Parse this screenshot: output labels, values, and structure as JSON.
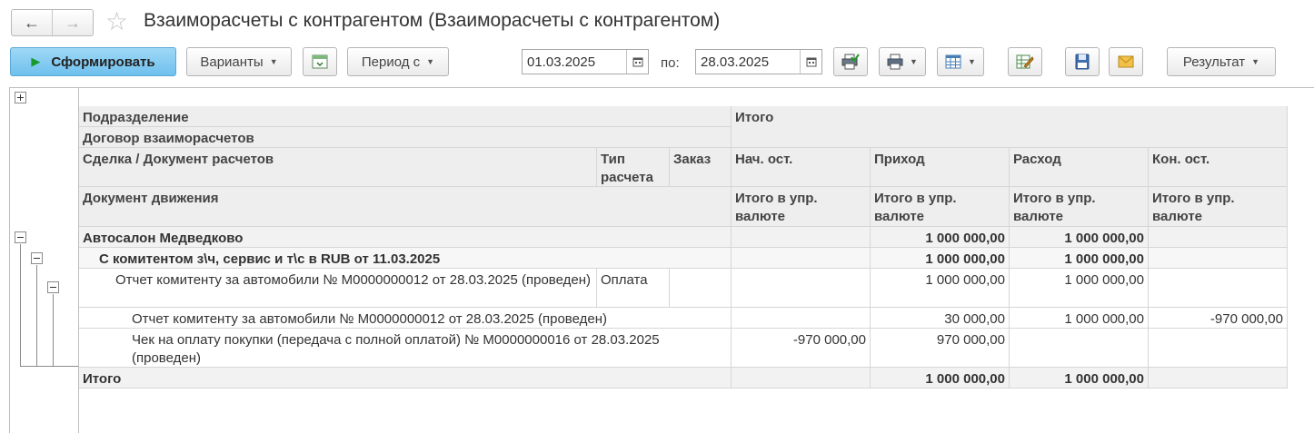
{
  "window": {
    "title": "Взаиморасчеты с контрагентом (Взаиморасчеты с контрагентом)"
  },
  "nav": {
    "back_icon": "arrow-left-icon",
    "forward_icon": "arrow-right-icon",
    "favorite_icon": "star-icon"
  },
  "toolbar": {
    "generate_label": "Сформировать",
    "variants_label": "Варианты",
    "period_label": "Период с",
    "date_from": "01.03.2025",
    "to_label": "по:",
    "date_to": "28.03.2025",
    "result_label": "Результат"
  },
  "table": {
    "headers": {
      "division": "Подразделение",
      "contract": "Договор взаиморасчетов",
      "deal": "Сделка / Документ расчетов",
      "calc_type": "Тип расчета",
      "order": "Заказ",
      "movement_doc": "Документ движения",
      "total": "Итого",
      "opening": "Нач. ост.",
      "income": "Приход",
      "expense": "Расход",
      "closing": "Кон. ост.",
      "sub_opening": "Итого в упр. валюте",
      "sub_income": "Итого в упр. валюте",
      "sub_expense": "Итого в упр. валюте",
      "sub_closing": "Итого в упр. валюте"
    },
    "rows": [
      {
        "name": "Автосалон Медведково",
        "type": "",
        "order": "",
        "opening": "",
        "income": "1 000 000,00",
        "expense": "1 000 000,00",
        "closing": ""
      },
      {
        "name": "С комитентом з\\ч, сервис и т\\с в RUB от 11.03.2025",
        "type": "",
        "order": "",
        "opening": "",
        "income": "1 000 000,00",
        "expense": "1 000 000,00",
        "closing": ""
      },
      {
        "name": "Отчет комитенту за автомобили № М0000000012 от 28.03.2025 (проведен)",
        "type": "Оплата",
        "order": "",
        "opening": "",
        "income": "1 000 000,00",
        "expense": "1 000 000,00",
        "closing": ""
      },
      {
        "name": "Отчет комитенту за автомобили № М0000000012 от 28.03.2025 (проведен)",
        "type": "",
        "order": "",
        "opening": "",
        "income": "30 000,00",
        "expense": "1 000 000,00",
        "closing": "-970 000,00"
      },
      {
        "name": "Чек на оплату покупки (передача с полной оплатой) № М0000000016 от 28.03.2025 (проведен)",
        "type": "",
        "order": "",
        "opening": "-970 000,00",
        "income": "970 000,00",
        "expense": "",
        "closing": ""
      },
      {
        "name": "Итого",
        "type": "",
        "order": "",
        "opening": "",
        "income": "1 000 000,00",
        "expense": "1 000 000,00",
        "closing": ""
      }
    ]
  }
}
